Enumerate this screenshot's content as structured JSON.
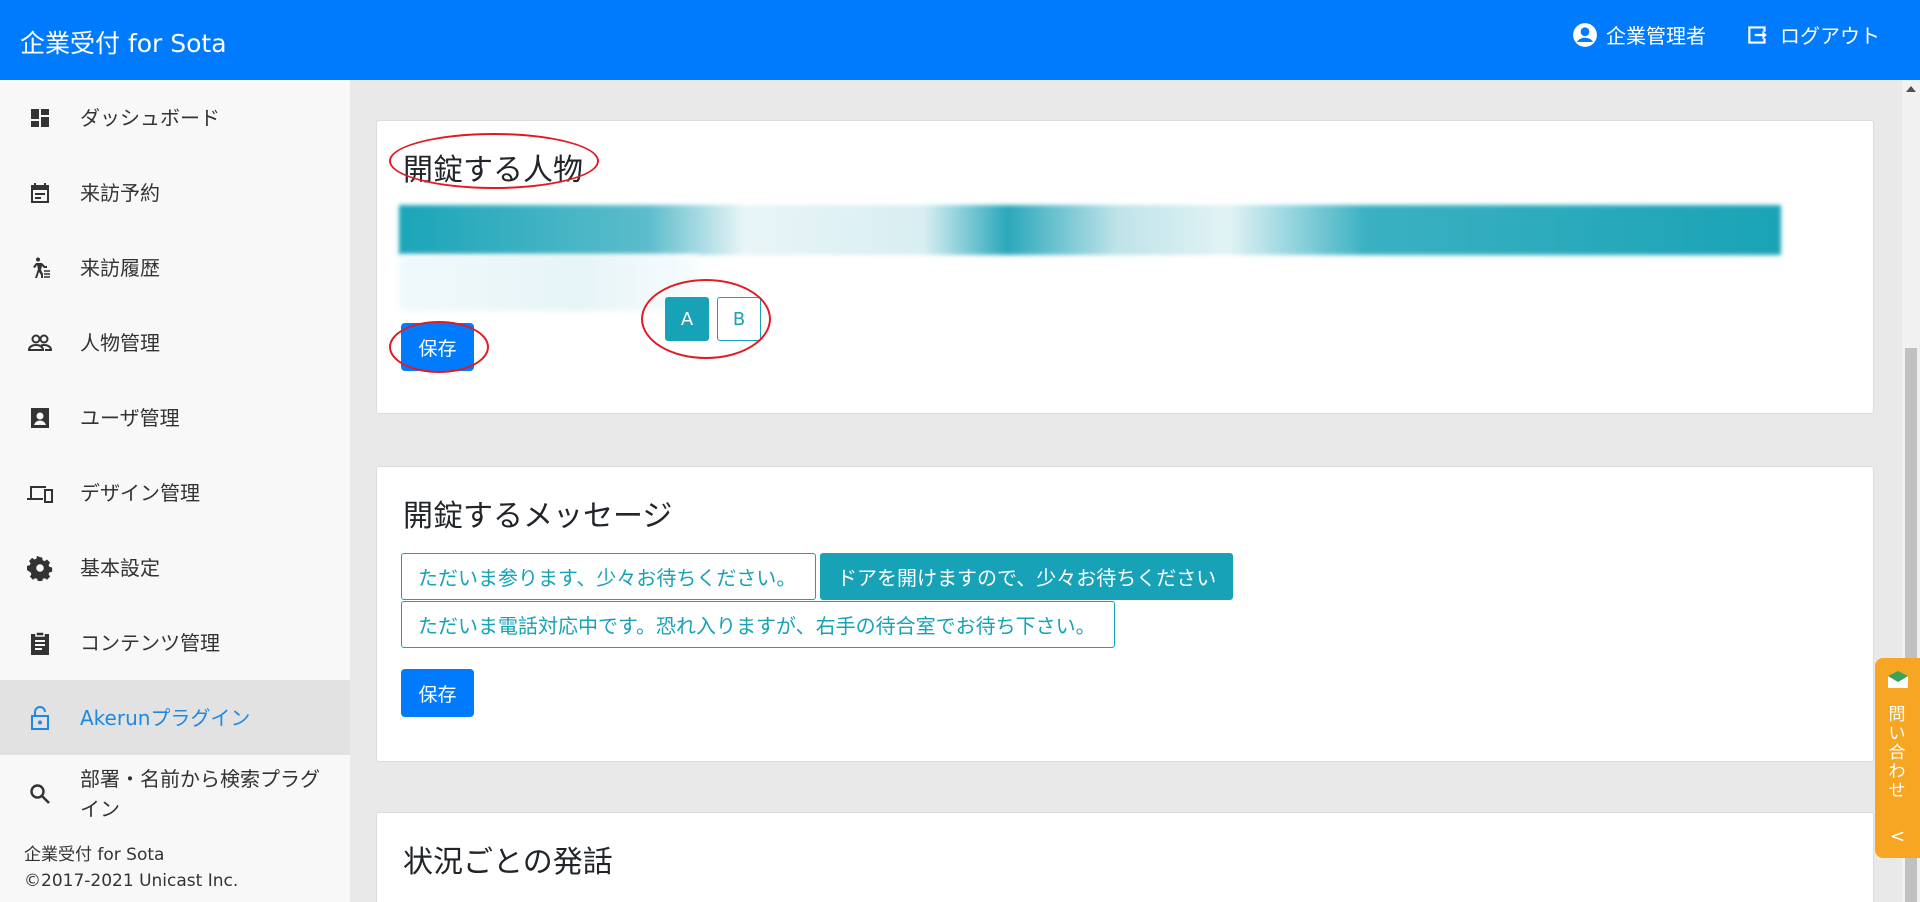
{
  "header": {
    "brand": "企業受付 for Sota",
    "user_label": "企業管理者",
    "logout_label": "ログアウト"
  },
  "sidebar": {
    "items": [
      {
        "label": "ダッシュボード",
        "icon": "dashboard-icon"
      },
      {
        "label": "来訪予約",
        "icon": "calendar-icon"
      },
      {
        "label": "来訪履歴",
        "icon": "walking-icon"
      },
      {
        "label": "人物管理",
        "icon": "people-icon"
      },
      {
        "label": "ユーザ管理",
        "icon": "contact-card-icon"
      },
      {
        "label": "デザイン管理",
        "icon": "devices-icon"
      },
      {
        "label": "基本設定",
        "icon": "gear-icon"
      },
      {
        "label": "コンテンツ管理",
        "icon": "clipboard-icon"
      },
      {
        "label": "Akerunプラグイン",
        "icon": "lock-open-icon",
        "active": true
      },
      {
        "label": "部署・名前から検索プラグイン",
        "icon": "search-icon"
      }
    ],
    "footer": {
      "app_name": "企業受付 for Sota",
      "copyright": "©2017-2021 Unicast Inc."
    }
  },
  "main": {
    "person_card": {
      "title": "開錠する人物",
      "options": [
        "A",
        "B"
      ],
      "selected": "A",
      "save_label": "保存"
    },
    "message_card": {
      "title": "開錠するメッセージ",
      "messages": [
        {
          "label": "ただいま参ります、少々お待ちください。",
          "selected": false
        },
        {
          "label": "ドアを開けますので、少々お待ちください",
          "selected": true
        },
        {
          "label": "ただいま電話対応中です。恐れ入りますが、右手の待合室でお待ち下さい。",
          "selected": false
        }
      ],
      "save_label": "保存"
    },
    "situation_card": {
      "title": "状況ごとの発話"
    }
  },
  "contact_tab": {
    "label": "問い合わせ",
    "arrow": "<"
  },
  "colors": {
    "header": "#017bfe",
    "accent_teal": "#17a2b8",
    "primary": "#017bfe",
    "annotation_red": "#e01b24",
    "contact_tab": "#f6a623"
  }
}
